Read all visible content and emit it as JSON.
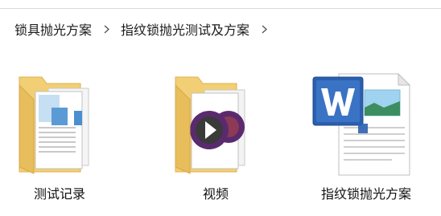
{
  "breadcrumb": {
    "items": [
      "锁具抛光方案",
      "指纹锁抛光测试及方案"
    ]
  },
  "files": [
    {
      "name": "测试记录",
      "type": "folder",
      "icon": "folder-with-documents-icon"
    },
    {
      "name": "视频",
      "type": "folder",
      "icon": "folder-with-video-icon"
    },
    {
      "name": "指纹锁抛光方案",
      "type": "word-document",
      "icon": "word-document-icon"
    }
  ],
  "colors": {
    "folder": "#f2cf74",
    "folder_dark": "#dfb04e",
    "word_blue": "#2b5faf",
    "video_purple": "#5a2a6f"
  }
}
